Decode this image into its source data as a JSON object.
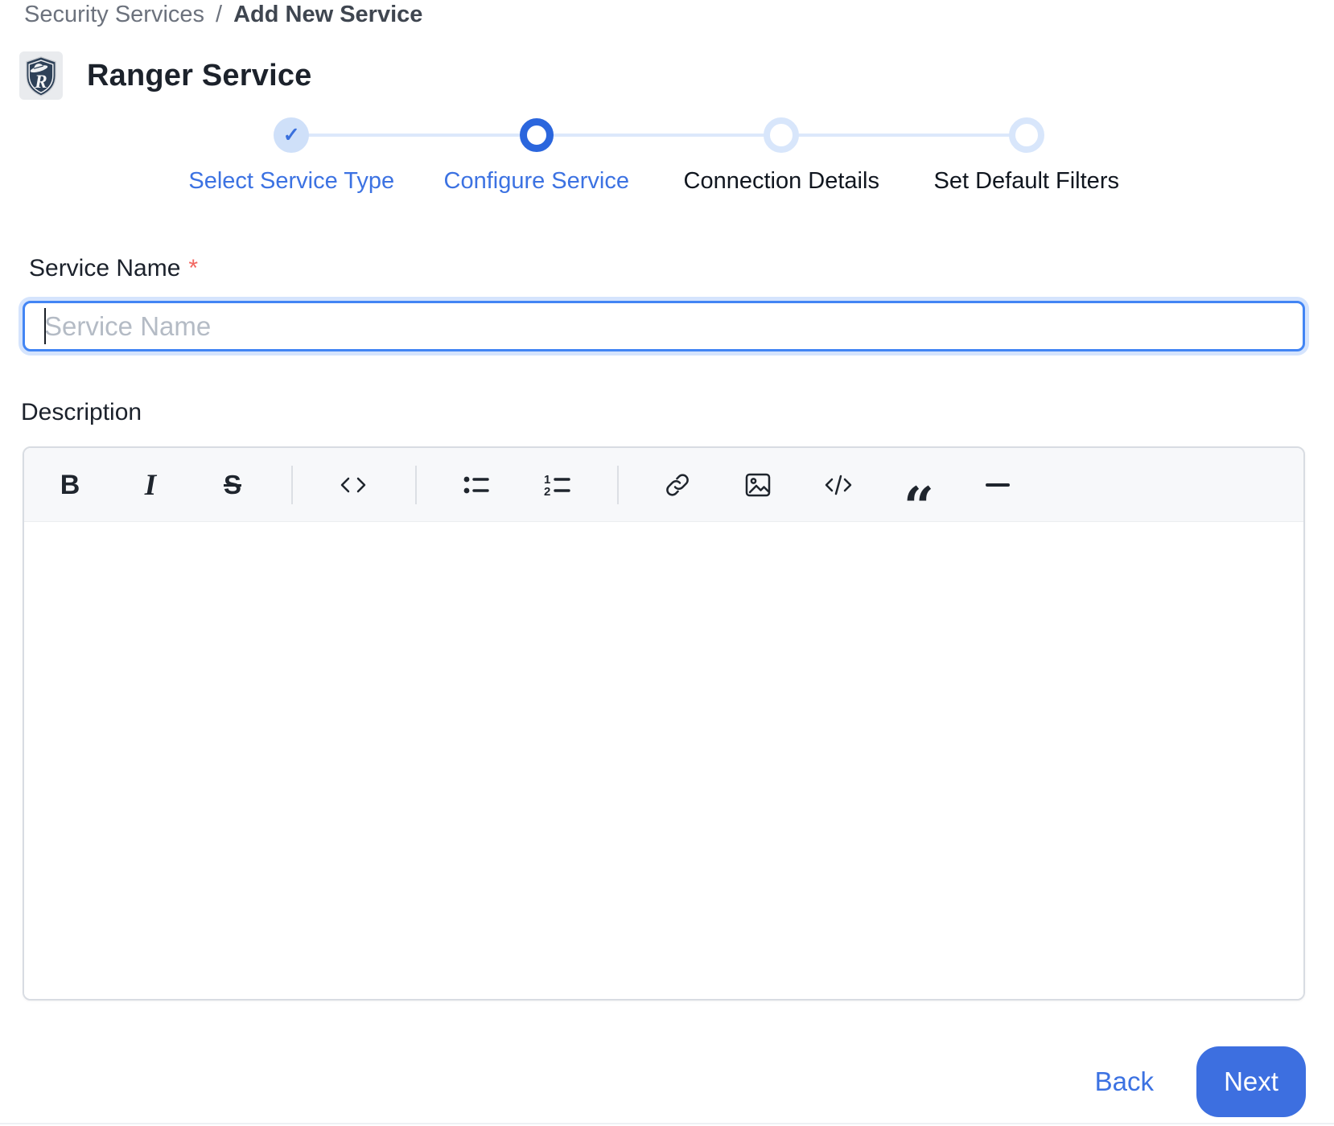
{
  "breadcrumb": {
    "section": "Security Services",
    "separator": "/",
    "current": "Add New Service"
  },
  "header": {
    "title": "Ranger Service"
  },
  "logo": {
    "letter": "R"
  },
  "stepper": {
    "check_glyph": "✓",
    "steps": [
      {
        "label": "Select Service Type",
        "state": "completed"
      },
      {
        "label": "Configure Service",
        "state": "active"
      },
      {
        "label": "Connection Details",
        "state": "upcoming"
      },
      {
        "label": "Set Default Filters",
        "state": "upcoming"
      }
    ]
  },
  "form": {
    "service_name": {
      "label": "Service Name",
      "required_marker": "*",
      "placeholder": "Service Name",
      "value": ""
    },
    "description": {
      "label": "Description",
      "value": ""
    }
  },
  "editor_toolbar": {
    "bold": "B",
    "italic": "I",
    "strikethrough": "S",
    "quote_glyph": "“",
    "buttons": [
      "bold",
      "italic",
      "strikethrough",
      "inline-code",
      "bullet-list",
      "ordered-list",
      "link",
      "image",
      "code-block",
      "blockquote",
      "horizontal-rule"
    ]
  },
  "footer": {
    "back": "Back",
    "next": "Next"
  },
  "colors": {
    "accent_blue": "#3c72e2",
    "active_ring_blue": "#2b66dd",
    "completed_fill": "#cfe0f9",
    "upcoming_ring": "#d8e6fb",
    "connector": "#dce8fb",
    "input_focus_blue": "#4285f4",
    "required_red": "#f26660",
    "next_button_blue": "#3d6fe0",
    "toolbar_bg": "#f7f8fa"
  }
}
